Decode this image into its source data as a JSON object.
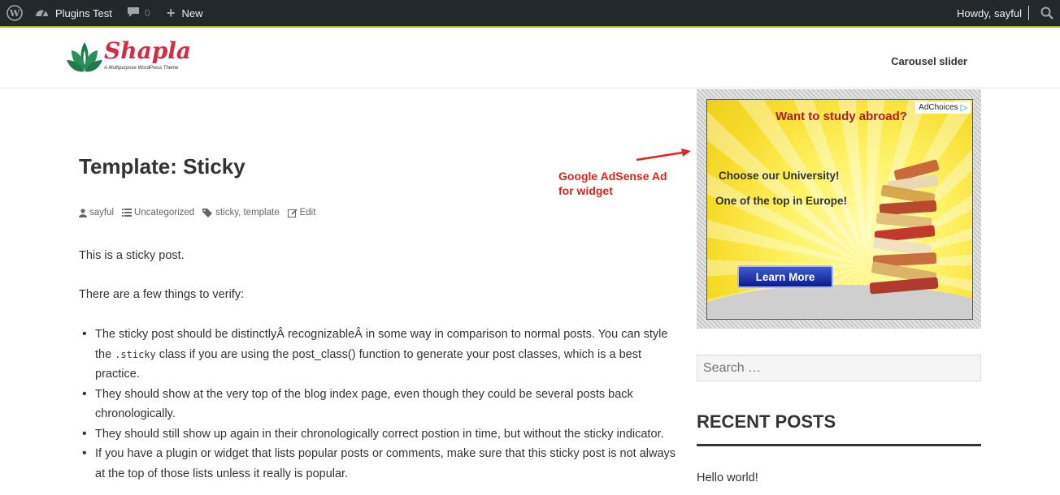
{
  "adminbar": {
    "site_name": "Plugins Test",
    "comments_count": "0",
    "new_label": "New",
    "howdy": "Howdy, sayful"
  },
  "header": {
    "logo_text": "Shapla",
    "logo_tagline": "A Multipurpose WordPress Theme",
    "nav_items": [
      "Carousel slider"
    ]
  },
  "post": {
    "title": "Template: Sticky",
    "meta": {
      "author": "sayful",
      "category": "Uncategorized",
      "tags": "sticky, template",
      "edit": "Edit"
    },
    "para1": "This is a sticky post.",
    "para2": "There are a few things to verify:",
    "list": [
      {
        "before_code": "The sticky post should be distinctlyÂ recognizableÂ in some way in comparison to normal posts. You can style the ",
        "code": ".sticky",
        "after_code": " class if you are using the post_class() function to generate your post classes, which is a best practice."
      },
      {
        "text": "They should show at the very top of the blog index page, even though they could be several posts back chronologically."
      },
      {
        "text": "They should still show up again in their chronologically correct postion in time, but without the sticky indicator."
      },
      {
        "text": "If you have a plugin or widget that lists popular posts or comments, make sure that this sticky post is not always at the top of those lists unless it really is popular."
      }
    ]
  },
  "annotation": {
    "line1": "Google AdSense Ad",
    "line2": "for widget",
    "color": "#e2231a"
  },
  "ad": {
    "adchoices": "AdChoices",
    "headline": "Want to study abroad?",
    "line1": "Choose our University!",
    "line2": "One of the top in Europe!",
    "button": "Learn More"
  },
  "sidebar": {
    "search_placeholder": "Search …",
    "recent_heading": "RECENT POSTS",
    "recent_posts": [
      "Hello world!"
    ]
  }
}
